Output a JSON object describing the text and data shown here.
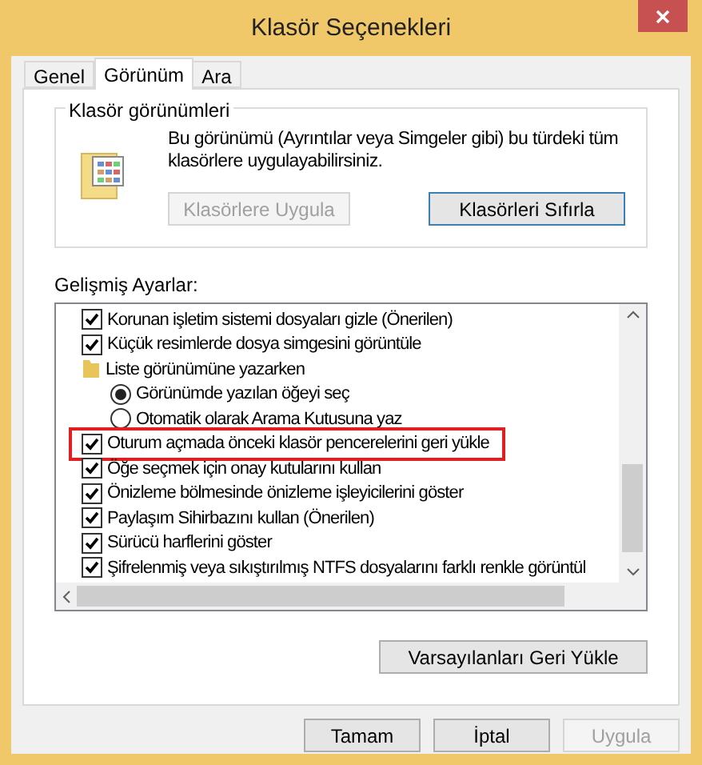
{
  "window": {
    "title": "Klasör Seçenekleri"
  },
  "tabs": [
    {
      "label": "Genel",
      "selected": false
    },
    {
      "label": "Görünüm",
      "selected": true
    },
    {
      "label": "Ara",
      "selected": false
    }
  ],
  "folder_views": {
    "title": "Klasör görünümleri",
    "description": "Bu görünümü (Ayrıntılar veya Simgeler gibi) bu türdeki tüm klasörlere uygulayabilirsiniz.",
    "buttons": [
      {
        "label": "Klasörlere Uygula",
        "disabled": true
      },
      {
        "label": "Klasörleri Sıfırla",
        "disabled": false
      }
    ]
  },
  "advanced": {
    "label": "Gelişmiş Ayarlar:",
    "items": [
      {
        "kind": "checkbox",
        "label": "Korunan işletim sistemi dosyaları gizle (Önerilen)",
        "checked": true,
        "highlighted": false
      },
      {
        "kind": "checkbox",
        "label": "Küçük resimlerde dosya simgesini görüntüle",
        "checked": true,
        "highlighted": false
      },
      {
        "kind": "folder",
        "label": "Liste görünümüne yazarken",
        "highlighted": false,
        "children": [
          {
            "kind": "radio",
            "label": "Görünümde yazılan öğeyi seç",
            "selected": true,
            "highlighted": false
          },
          {
            "kind": "radio",
            "label": "Otomatik olarak Arama Kutusuna yaz",
            "selected": false,
            "highlighted": false
          }
        ]
      },
      {
        "kind": "checkbox",
        "label": "Oturum açmada önceki klasör pencerelerini geri yükle",
        "checked": true,
        "highlighted": true
      },
      {
        "kind": "checkbox",
        "label": "Öğe seçmek için onay kutularını kullan",
        "checked": true,
        "highlighted": false
      },
      {
        "kind": "checkbox",
        "label": "Önizleme bölmesinde önizleme işleyicilerini göster",
        "checked": true,
        "highlighted": false
      },
      {
        "kind": "checkbox",
        "label": "Paylaşım Sihirbazını kullan (Önerilen)",
        "checked": true,
        "highlighted": false
      },
      {
        "kind": "checkbox",
        "label": "Sürücü harflerini göster",
        "checked": true,
        "highlighted": false
      },
      {
        "kind": "checkbox",
        "label": "Şifrelenmiş veya sıkıştırılmış NTFS dosyalarını farklı renkle görüntül",
        "checked": true,
        "highlighted": false
      }
    ]
  },
  "restore_button": {
    "label": "Varsayılanları Geri Yükle"
  },
  "buttons": [
    {
      "label": "Tamam",
      "disabled": false
    },
    {
      "label": "İptal",
      "disabled": false
    },
    {
      "label": "Uygula",
      "disabled": true
    }
  ]
}
